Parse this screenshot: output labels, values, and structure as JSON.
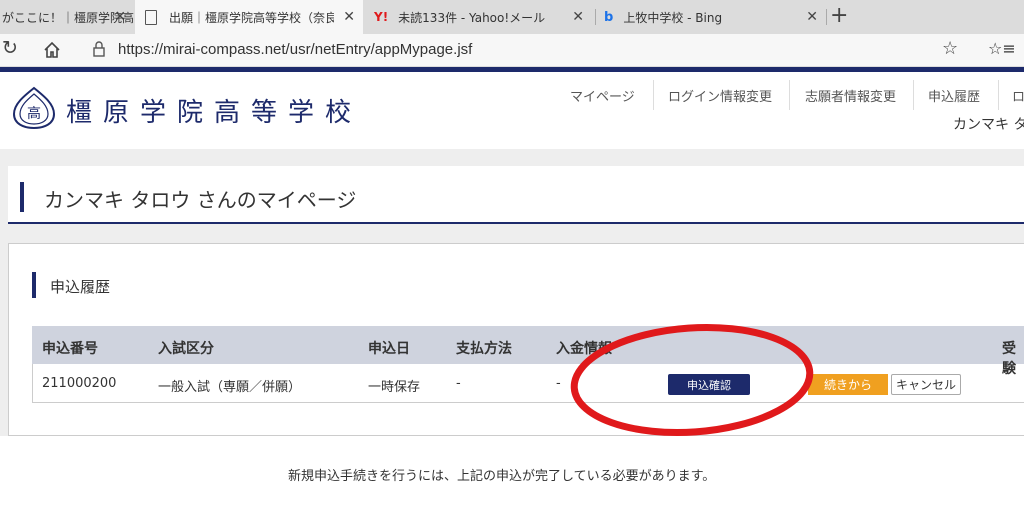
{
  "browser": {
    "tabs": [
      {
        "title": "がここに！｜橿原学院高"
      },
      {
        "title": "出願｜橿原学院高等学校（奈良"
      },
      {
        "title": "未読133件 - Yahoo!メール"
      },
      {
        "title": "上牧中学校 - Bing"
      }
    ],
    "new_tab": "+",
    "url": "https://mirai-compass.net/usr/netEntry/appMypage.jsf"
  },
  "site": {
    "school_name": "橿原学院高等学校",
    "logo_char": "高",
    "nav": [
      "マイページ",
      "ログイン情報変更",
      "志願者情報変更",
      "申込履歴",
      "ロ"
    ],
    "user_name_short": "カンマキ タ"
  },
  "page": {
    "title": "カンマキ タロウ さんのマイページ",
    "history_heading": "申込履歴",
    "table": {
      "headers": [
        "申込番号",
        "入試区分",
        "申込日",
        "支払方法",
        "入金情報",
        "受験"
      ],
      "row": {
        "number": "211000200",
        "exam_type": "一般入試（専願／併願）",
        "date": "一時保存",
        "payment": "-",
        "deposit": "-"
      }
    },
    "buttons": {
      "confirm": "申込確認",
      "continue": "続きから",
      "cancel": "キャンセル"
    },
    "notice": "新規申込手続きを行うには、上記の申込が完了している必要があります。"
  },
  "colors": {
    "navy": "#1d2a6b",
    "orange": "#f0a020",
    "annotation_red": "#e0191b"
  }
}
